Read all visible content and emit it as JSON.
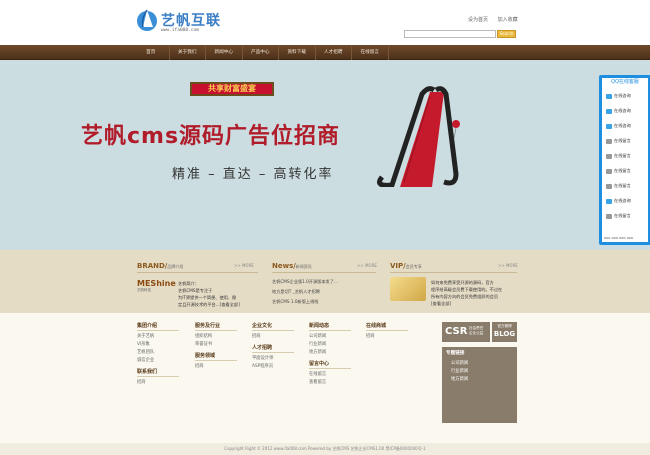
{
  "header": {
    "logo_text": "艺帆互联",
    "logo_url": "www.ifa008.com",
    "top_links": [
      "设为首页",
      "加入收藏"
    ],
    "search_btn": "Search"
  },
  "nav": [
    "首页",
    "关于我们",
    "新闻中心",
    "产品中心",
    "资料下载",
    "人才招聘",
    "在线留言"
  ],
  "banner": {
    "tag": "共享财富盛宴",
    "title": "艺帆cms源码广告位招商",
    "subtitle": "精准 – 直达 – 高转化率"
  },
  "qq": {
    "title": "QQ在线客服",
    "items": [
      {
        "label": "在线咨询",
        "on": true
      },
      {
        "label": "在线咨询",
        "on": true
      },
      {
        "label": "在线咨询",
        "on": true
      },
      {
        "label": "在线留言",
        "on": false
      },
      {
        "label": "在线留言",
        "on": false
      },
      {
        "label": "在线留言",
        "on": false
      },
      {
        "label": "在线留言",
        "on": false
      },
      {
        "label": "在线咨询",
        "on": true
      },
      {
        "label": "在线留言",
        "on": false
      }
    ],
    "foot": "ooo ooo ooo ooo"
  },
  "brand": {
    "heading": "BRAND/",
    "sub": "品牌介绍",
    "more": ">> MORE",
    "logo": "MEShine",
    "logo_sub": "艺帆科技",
    "text": [
      "艺帆简介：",
      "艺帆CMS是专注于",
      "为IT界提供一个简便、使用、稳",
      "定且开源技术的平台...[查看全部]"
    ]
  },
  "news": {
    "heading": "News/",
    "sub": "新闻资讯",
    "more": ">> MORE",
    "items": [
      "艺帆CMS企业版1.0开源版本发了...",
      "地方是切T _艺帆人才招聘",
      "艺帆CMS 1.0新版上线啦"
    ]
  },
  "vip": {
    "heading": "VIP/",
    "sub": "会员专享",
    "more": ">> MORE",
    "text": [
      "如何来免费享受开源的源码，官方",
      "程序给高级会员费下载使用的。不过在",
      "所有内容方向的会员免费组织的会员",
      "[查看全部]"
    ]
  },
  "footer": {
    "col1": {
      "title": "集团介绍",
      "links": [
        "关于艺帆",
        "VI形象",
        "艺帆团队",
        "诚信企业"
      ]
    },
    "col1b": {
      "title": "联系我们",
      "links": [
        "招商"
      ]
    },
    "col2": {
      "title": "服务及行业",
      "links": [
        "组织结构",
        "荣誉证书"
      ]
    },
    "col2b": {
      "title": "服务领域",
      "links": [
        "招商"
      ]
    },
    "col3": {
      "title": "企业文化",
      "links": [
        "招商"
      ]
    },
    "col3b": {
      "title": "人才招聘",
      "links": [
        "平面设计师",
        "ASP程序员"
      ]
    },
    "col4": {
      "title": "新闻动态",
      "links": [
        "公司新闻",
        "行业新闻",
        "地方新闻"
      ]
    },
    "col4b": {
      "title": "留言中心",
      "links": [
        "在线留言",
        "查看留言"
      ]
    },
    "col5": {
      "title": "在线商城",
      "links": [
        "招商"
      ]
    },
    "csr": "CSR",
    "csr_sub": [
      "社会责任",
      "企业公益"
    ],
    "blog": "BLOG",
    "blog_sub": "官方微博",
    "box": {
      "title": "专题链接",
      "links": [
        "公司新闻",
        "行业新闻",
        "地方新闻"
      ]
    }
  },
  "copyright": "Copyright Right © 2012 www.ifa008.com Powered by 艺帆CMS 艺帆企业CMS1.00 黑ICP备0000000号-1"
}
